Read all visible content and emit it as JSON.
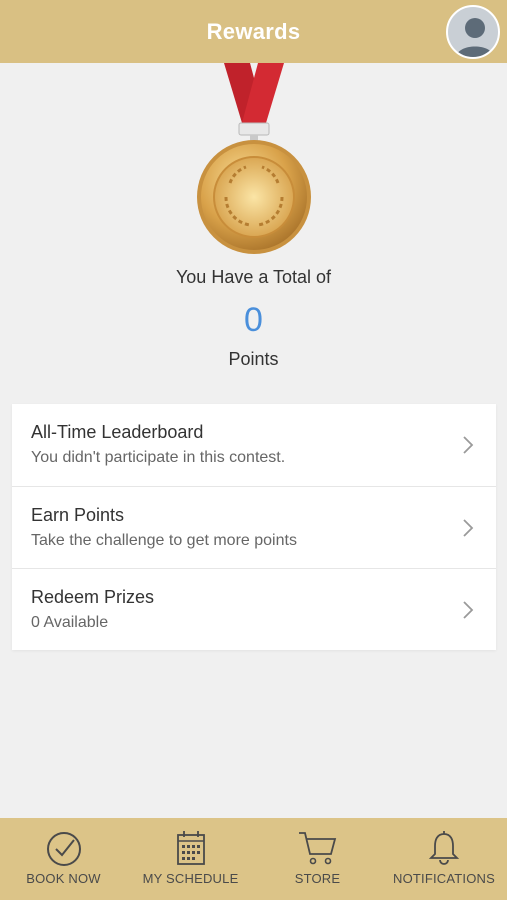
{
  "header": {
    "title": "Rewards"
  },
  "summary": {
    "total_label": "You Have a Total of",
    "points_value": "0",
    "points_unit": "Points"
  },
  "menu": {
    "items": [
      {
        "title": "All-Time Leaderboard",
        "subtitle": "You didn't participate in this contest."
      },
      {
        "title": "Earn Points",
        "subtitle": "Take the challenge to get more points"
      },
      {
        "title": "Redeem Prizes",
        "subtitle": "0 Available"
      }
    ]
  },
  "tabbar": {
    "tabs": [
      {
        "label": "BOOK NOW",
        "icon": "check-circle-icon"
      },
      {
        "label": "MY SCHEDULE",
        "icon": "calendar-icon"
      },
      {
        "label": "STORE",
        "icon": "cart-icon"
      },
      {
        "label": "NOTIFICATIONS",
        "icon": "bell-icon"
      }
    ]
  },
  "colors": {
    "header_bg": "#d9c083",
    "tabbar_bg": "#dcc488",
    "points_accent": "#4a8fdb",
    "page_bg": "#f0f0f0"
  }
}
